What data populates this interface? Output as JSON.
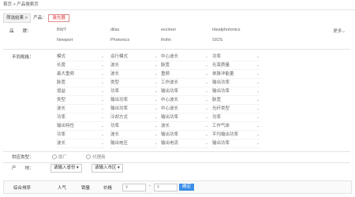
{
  "breadcrumb": {
    "home": "首页",
    "sep": ">",
    "current": "产品搜索页"
  },
  "filter": {
    "label": "筛选结果 >",
    "product_label": "产品：",
    "tag": "激光器"
  },
  "brands": {
    "title": "品　　牌：",
    "items": [
      "BWT",
      "dilas",
      "excimer",
      "Idealphotonics",
      "Newport",
      "Photonics",
      "Rofin",
      "SIOS"
    ],
    "more": "更多"
  },
  "specs": {
    "title": "不同规格：",
    "rows": [
      [
        "模式",
        "运行模式",
        "中心波长",
        "功率"
      ],
      [
        "长度",
        "波长",
        "脉宽",
        "光束质量"
      ],
      [
        "最大重频",
        "波长",
        "重频",
        "单脉冲能量"
      ],
      [
        "脉宽",
        "类型",
        "工作波长",
        "输出功率"
      ],
      [
        "增益",
        "功率",
        "输出功率",
        "输出功率"
      ],
      [
        "类型",
        "输出功率",
        "中心波长",
        "脉宽"
      ],
      [
        "波长",
        "输出功率",
        "中心波长",
        "光纤类型"
      ],
      [
        "功率",
        "冷却方式",
        "输出功率",
        "功率"
      ],
      [
        "输出特性",
        "功率",
        "波长",
        "工作气体"
      ],
      [
        "功率",
        "波长",
        "输出功率",
        "平均输出功率"
      ],
      [
        "波长",
        "输出电压",
        "输出电流",
        "输出功率"
      ]
    ]
  },
  "supply": {
    "title": "供应类型：",
    "opt1": "原厂",
    "opt2": "代理商"
  },
  "origin": {
    "title": "产　　地：",
    "province": "请输入省份",
    "city": "请输入市区"
  },
  "sort": {
    "label": "综合排序",
    "popularity": "人气",
    "sales": "销量",
    "price": "价格",
    "min": "¥",
    "dash": "-",
    "max": "¥",
    "confirm": "确定"
  }
}
